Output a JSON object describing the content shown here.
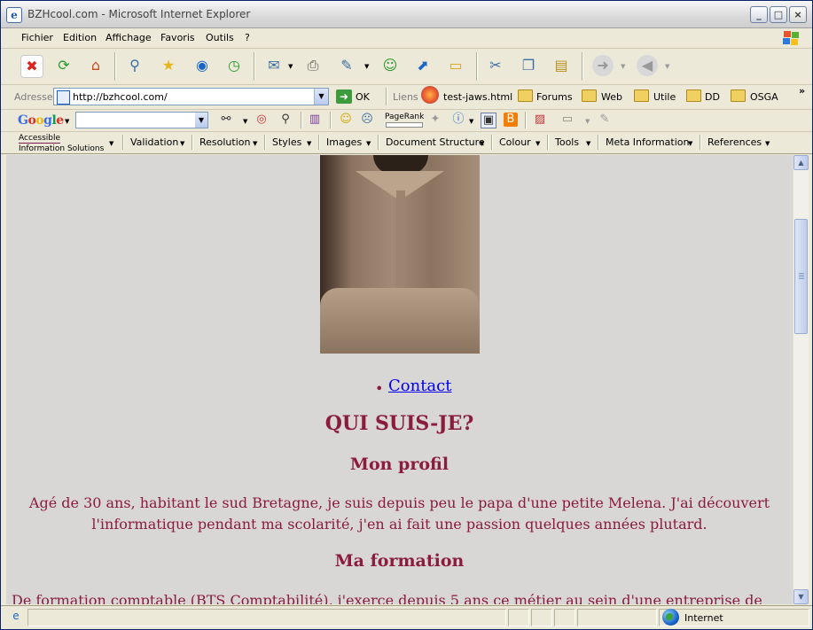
{
  "window": {
    "title": "BZHcool.com - Microsoft Internet Explorer",
    "buttons": {
      "minimize": "_",
      "maximize": "□",
      "close": "×"
    }
  },
  "menu": [
    "Fichier",
    "Edition",
    "Affichage",
    "Favoris",
    "Outils",
    "?"
  ],
  "toolbar": {
    "icons": [
      "stop-icon",
      "refresh-icon",
      "home-icon",
      "search-icon",
      "favorites-icon",
      "media-icon",
      "history-icon",
      "mail-icon",
      "print-icon",
      "edit-icon",
      "messenger-icon",
      "research-icon",
      "folder-icon",
      "cut-icon",
      "copy-icon",
      "paste-icon",
      "forward-icon",
      "back-icon"
    ]
  },
  "address": {
    "label": "Adresse",
    "url": "http://bzhcool.com/",
    "go_label": "OK",
    "links_label": "Liens",
    "links": [
      "test-jaws.html",
      "Forums",
      "Web",
      "Utile",
      "DD",
      "OSGA"
    ],
    "more": "»"
  },
  "google": {
    "logo": "Google",
    "pagerank_label": "PageRank"
  },
  "wat_toolbar": {
    "accessible_line1": "Accessible",
    "accessible_line2": "Information Solutions",
    "menus": [
      "Validation",
      "Resolution",
      "Styles",
      "Images",
      "Document Structure",
      "Colour",
      "Tools",
      "Meta Information",
      "References"
    ]
  },
  "page": {
    "contact_link": "Contact",
    "heading": "QUI SUIS-JE?",
    "profile_heading": "Mon profil",
    "profile_text_line1": "Agé de 30 ans, habitant le sud Bretagne, je suis depuis peu le papa d'une petite Melena. J'ai découvert",
    "profile_text_line2": "l'informatique pendant ma scolarité, j'en ai fait une passion quelques années plutard.",
    "training_heading": "Ma formation",
    "training_text": "De formation comptable (BTS Comptabilité), j'exerce depuis 5 ans ce métier au sein d'une entreprise de"
  },
  "status": {
    "zone": "Internet"
  },
  "colors": {
    "page_text": "#8a1c3e",
    "link": "#0000ee",
    "page_bg": "#d9d6d6"
  }
}
